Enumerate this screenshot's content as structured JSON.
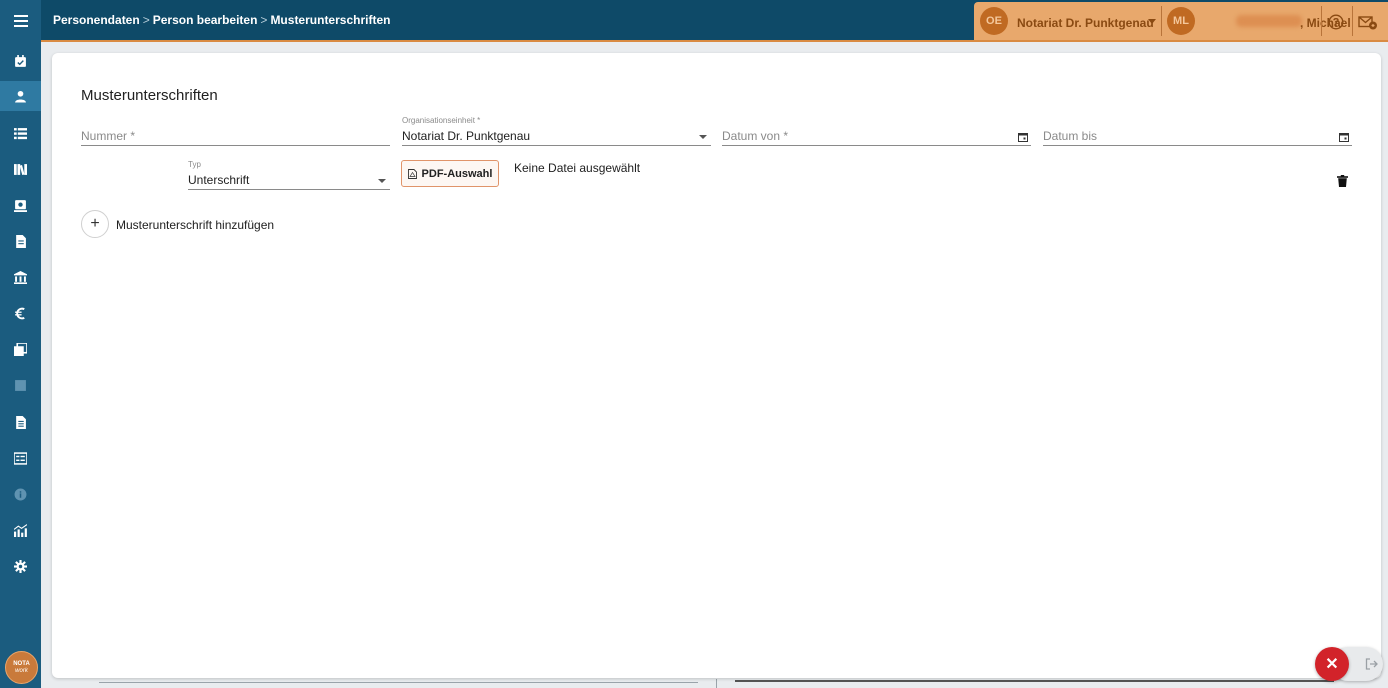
{
  "breadcrumb": {
    "items": [
      "Personendaten",
      "Person bearbeiten",
      "Musterunterschriften"
    ],
    "separator": ">"
  },
  "org": {
    "initials": "OE",
    "name": "Notariat Dr. Punktgenau"
  },
  "user": {
    "initials": "ML",
    "name": ", Michael"
  },
  "sidebar": {
    "icons": [
      "menu-icon",
      "calendar-check-icon",
      "person-icon",
      "list-icon",
      "library-icon",
      "safe-icon",
      "document-icon",
      "bank-icon",
      "euro-icon",
      "copy-icon",
      "square-icon",
      "page-icon",
      "form-icon",
      "info-icon",
      "chart-icon",
      "settings-icon"
    ],
    "logo_top": "NOTA",
    "logo_bottom": "work"
  },
  "card": {
    "title": "Musterunterschriften",
    "nummer_placeholder": "Nummer *",
    "org_unit_label": "Organisationseinheit *",
    "org_unit_value": "Notariat Dr. Punktgenau",
    "datum_von_placeholder": "Datum von *",
    "datum_bis_placeholder": "Datum bis",
    "typ_label": "Typ",
    "typ_value": "Unterschrift",
    "pdf_button": "PDF-Auswahl",
    "no_file": "Keine Datei ausgewählt",
    "add_label": "Musterunterschrift hinzufügen",
    "add_symbol": "+"
  },
  "fab": {
    "close_symbol": "✕"
  },
  "colors": {
    "sidebar": "#1b5c7f",
    "topbar": "#0e4a68",
    "accent": "#e8a86c",
    "close": "#d2232a"
  }
}
